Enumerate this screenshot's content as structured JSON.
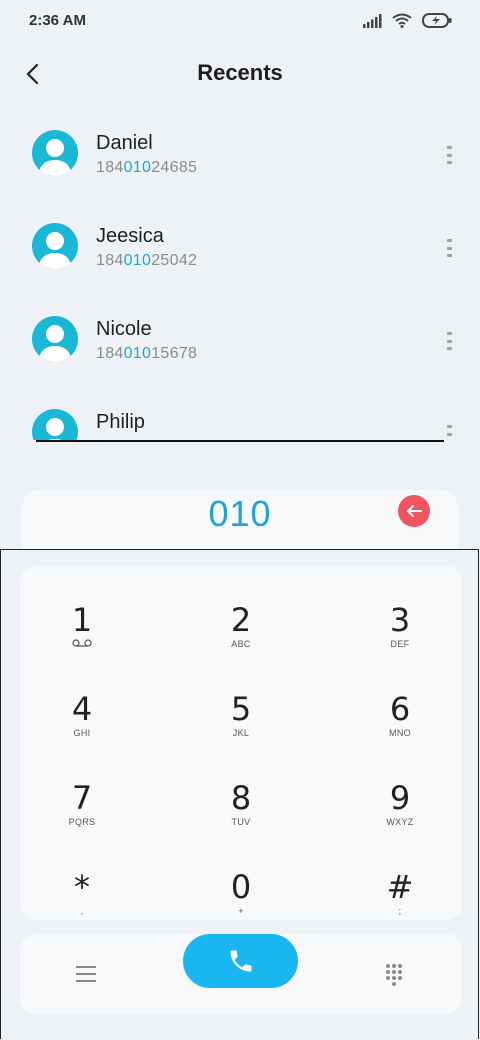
{
  "status": {
    "time": "2:36 AM"
  },
  "header": {
    "title": "Recents"
  },
  "contacts": [
    {
      "name": "Daniel",
      "number_pre": "184",
      "number_match": "010",
      "number_post": "24685"
    },
    {
      "name": "Jeesica",
      "number_pre": "184",
      "number_match": "010",
      "number_post": "25042"
    },
    {
      "name": "Nicole",
      "number_pre": "184",
      "number_match": "010",
      "number_post": "15678"
    },
    {
      "name": "Philip"
    }
  ],
  "dialer": {
    "entered_digits": "010",
    "keys": [
      {
        "digit": "1",
        "sub": ""
      },
      {
        "digit": "2",
        "sub": "ABC"
      },
      {
        "digit": "3",
        "sub": "DEF"
      },
      {
        "digit": "4",
        "sub": "GHI"
      },
      {
        "digit": "5",
        "sub": "JKL"
      },
      {
        "digit": "6",
        "sub": "MNO"
      },
      {
        "digit": "7",
        "sub": "PQRS"
      },
      {
        "digit": "8",
        "sub": "TUV"
      },
      {
        "digit": "9",
        "sub": "WXYZ"
      },
      {
        "digit": "*",
        "sub": ","
      },
      {
        "digit": "0",
        "sub": "+"
      },
      {
        "digit": "#",
        "sub": ";"
      }
    ]
  },
  "colors": {
    "accent": "#19b6f2",
    "avatar": "#19b8d6",
    "delete": "#f0555f",
    "match": "#19a9d6"
  },
  "icons": [
    "back-arrow-icon",
    "signal-icon",
    "wifi-icon",
    "battery-icon",
    "more-vert-icon",
    "backspace-icon",
    "voicemail-icon",
    "menu-icon",
    "phone-icon",
    "dialpad-icon"
  ]
}
